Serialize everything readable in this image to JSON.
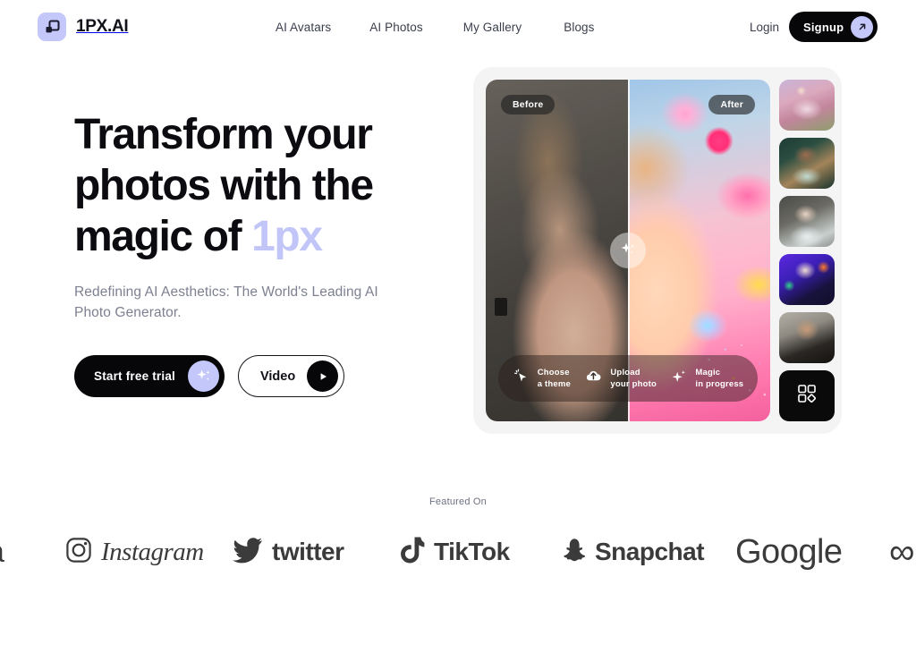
{
  "brand": {
    "name": "1PX.AI",
    "logo_icon": "grid-square-icon",
    "logo_bg": "#c4c7f9"
  },
  "nav": {
    "items": [
      {
        "label": "AI Avatars",
        "name": "nav-ai-avatars"
      },
      {
        "label": "AI Photos",
        "name": "nav-ai-photos"
      },
      {
        "label": "My Gallery",
        "name": "nav-my-gallery"
      },
      {
        "label": "Blogs",
        "name": "nav-blogs"
      }
    ],
    "login_label": "Login",
    "signup_label": "Signup",
    "signup_icon": "arrow-up-right-icon"
  },
  "hero": {
    "title_line1": "Transform your",
    "title_line2": "photos with the",
    "title_line3_prefix": "magic of ",
    "title_accent": "1px",
    "accent_color": "#c1c5f8",
    "subtitle": "Redefining AI Aesthetics: The World's Leading AI Photo Generator.",
    "primary_cta": {
      "label": "Start free trial",
      "icon": "sparkle-icon"
    },
    "secondary_cta": {
      "label": "Video",
      "icon": "play-icon"
    }
  },
  "showcase": {
    "before_label": "Before",
    "after_label": "After",
    "magic_button_icon": "sparkle-icon",
    "steps": [
      {
        "icon": "cursor-sparkle-icon",
        "line1": "Choose",
        "line2": "a theme"
      },
      {
        "icon": "cloud-upload-icon",
        "line1": "Upload",
        "line2": "your photo"
      },
      {
        "icon": "sparkle-icon",
        "line1": "Magic",
        "line2": "in progress"
      }
    ],
    "thumbnails": [
      {
        "name": "thumbnail-floral-portrait"
      },
      {
        "name": "thumbnail-golden-portrait"
      },
      {
        "name": "thumbnail-bridal-portrait"
      },
      {
        "name": "thumbnail-neon-portrait"
      },
      {
        "name": "thumbnail-male-portrait"
      },
      {
        "name": "thumbnail-more-styles",
        "icon": "grid-apps-icon"
      }
    ]
  },
  "featured": {
    "label": "Featured On",
    "logos": [
      {
        "name": "amazon-logo",
        "text": "a"
      },
      {
        "name": "instagram-logo",
        "text": "Instagram",
        "icon": "instagram-icon"
      },
      {
        "name": "twitter-logo",
        "text": "twitter",
        "icon": "twitter-bird-icon"
      },
      {
        "name": "tiktok-logo",
        "text": "TikTok",
        "icon": "tiktok-note-icon"
      },
      {
        "name": "snapchat-logo",
        "text": "Snapchat",
        "icon": "snapchat-ghost-icon"
      },
      {
        "name": "google-logo",
        "text": "Google"
      },
      {
        "name": "meta-logo",
        "text": "∞",
        "icon": "meta-infinity-icon"
      }
    ]
  }
}
